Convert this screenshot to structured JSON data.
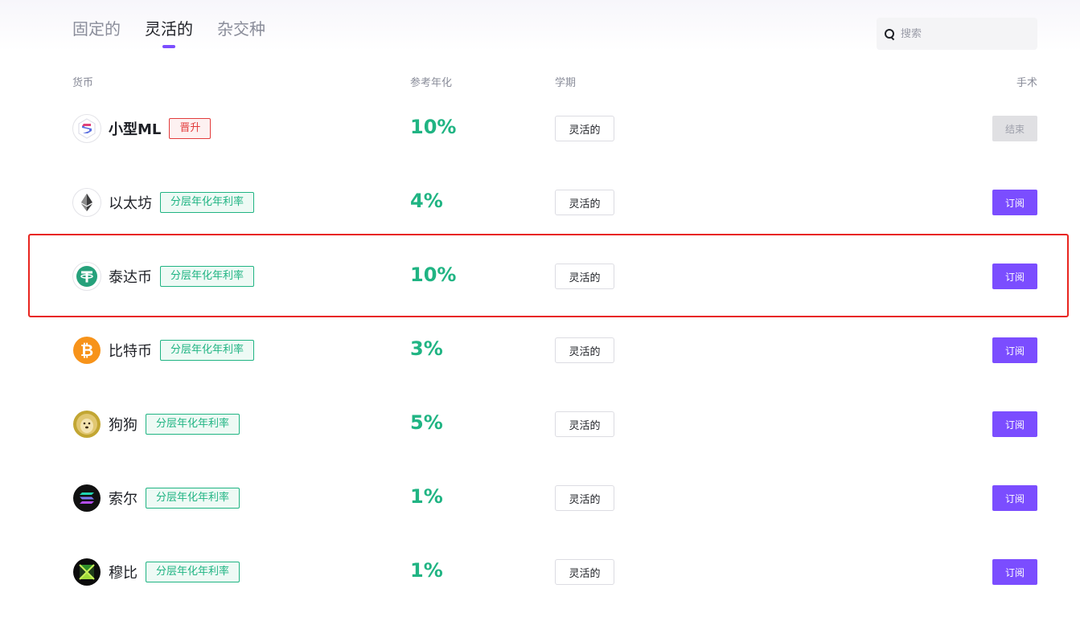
{
  "tabs": [
    {
      "label": "固定的",
      "active": false
    },
    {
      "label": "灵活的",
      "active": true
    },
    {
      "label": "杂交种",
      "active": false
    }
  ],
  "search": {
    "placeholder": "搜索"
  },
  "table": {
    "headers": {
      "coin": "货币",
      "apy": "参考年化",
      "term": "学期",
      "action": "手术"
    },
    "rows": [
      {
        "name": "小型ML",
        "badge": "晋升",
        "badge_type": "red",
        "apy": "10%",
        "term": "灵活的",
        "action": "结束",
        "action_state": "disabled",
        "icon": "smallml-logo-icon"
      },
      {
        "name": "以太坊",
        "badge": "分层年化年利率",
        "badge_type": "green",
        "apy": "4%",
        "term": "灵活的",
        "action": "订阅",
        "action_state": "primary",
        "icon": "ethereum-logo-icon"
      },
      {
        "name": "泰达币",
        "badge": "分层年化年利率",
        "badge_type": "green",
        "apy": "10%",
        "term": "灵活的",
        "action": "订阅",
        "action_state": "primary",
        "icon": "tether-logo-icon"
      },
      {
        "name": "比特币",
        "badge": "分层年化年利率",
        "badge_type": "green",
        "apy": "3%",
        "term": "灵活的",
        "action": "订阅",
        "action_state": "primary",
        "icon": "bitcoin-logo-icon"
      },
      {
        "name": "狗狗",
        "badge": "分层年化年利率",
        "badge_type": "green",
        "apy": "5%",
        "term": "灵活的",
        "action": "订阅",
        "action_state": "primary",
        "icon": "dogecoin-logo-icon"
      },
      {
        "name": "索尔",
        "badge": "分层年化年利率",
        "badge_type": "green",
        "apy": "1%",
        "term": "灵活的",
        "action": "订阅",
        "action_state": "primary",
        "icon": "solana-logo-icon"
      },
      {
        "name": "穆比",
        "badge": "分层年化年利率",
        "badge_type": "green",
        "apy": "1%",
        "term": "灵活的",
        "action": "订阅",
        "action_state": "primary",
        "icon": "mubi-logo-icon"
      }
    ]
  },
  "colors": {
    "accent": "#7b4dff",
    "green": "#20b483",
    "red": "#e23c3c",
    "highlight": "#e8251f"
  }
}
